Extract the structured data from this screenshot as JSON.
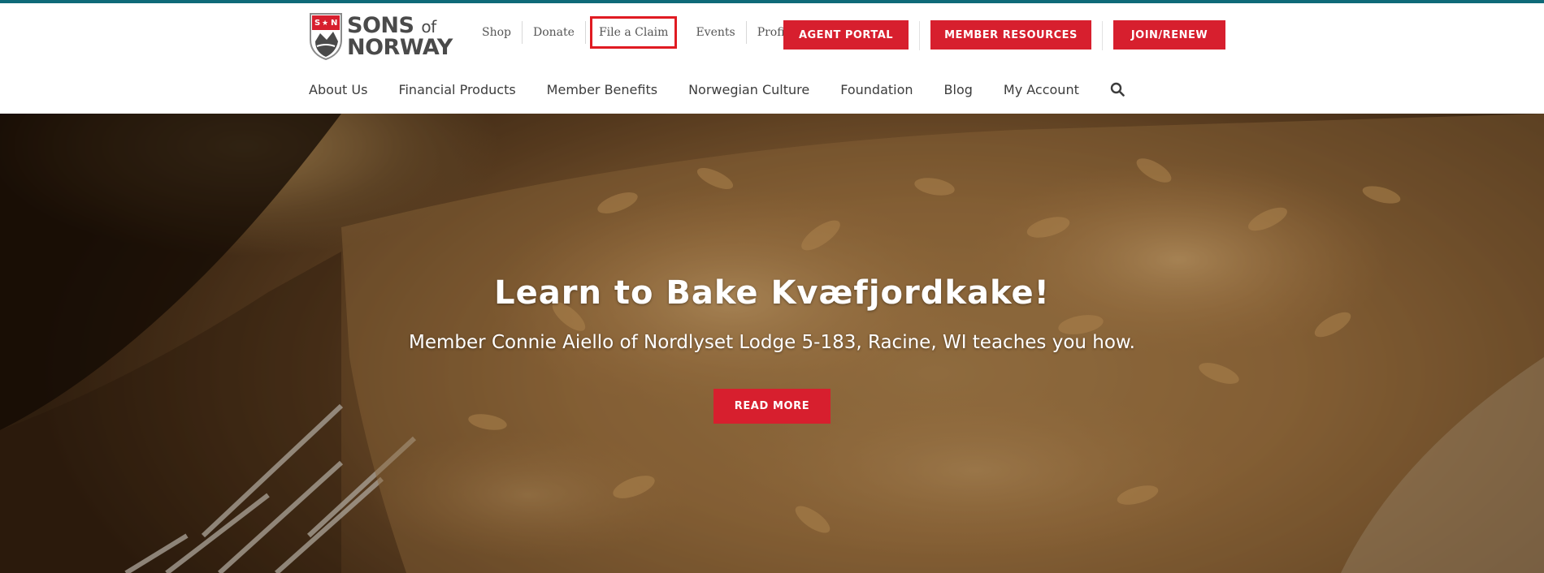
{
  "brand": {
    "line1": "SONS",
    "line1_small": "of",
    "line2": "NORWAY",
    "colors": {
      "accent": "#d71f2e",
      "top_border": "#0e6a78",
      "text": "#3c3c3c"
    }
  },
  "utility_links": [
    {
      "label": "Shop"
    },
    {
      "label": "Donate"
    },
    {
      "label": "File a Claim",
      "highlighted": true
    },
    {
      "label": "Events"
    },
    {
      "label": "Profile"
    }
  ],
  "cta_buttons": {
    "agent_portal": "AGENT PORTAL",
    "member_resources": "MEMBER RESOURCES",
    "join_renew": "JOIN/RENEW"
  },
  "main_nav": [
    {
      "label": "About Us"
    },
    {
      "label": "Financial Products"
    },
    {
      "label": "Member Benefits"
    },
    {
      "label": "Norwegian Culture"
    },
    {
      "label": "Foundation"
    },
    {
      "label": "Blog"
    },
    {
      "label": "My Account"
    }
  ],
  "search": {
    "icon": "search-icon"
  },
  "hero": {
    "title": "Learn to Bake Kvæfjordkake!",
    "subtitle": "Member Connie Aiello of Nordlyset Lodge 5-183, Racine, WI teaches you how.",
    "button": "READ MORE"
  }
}
